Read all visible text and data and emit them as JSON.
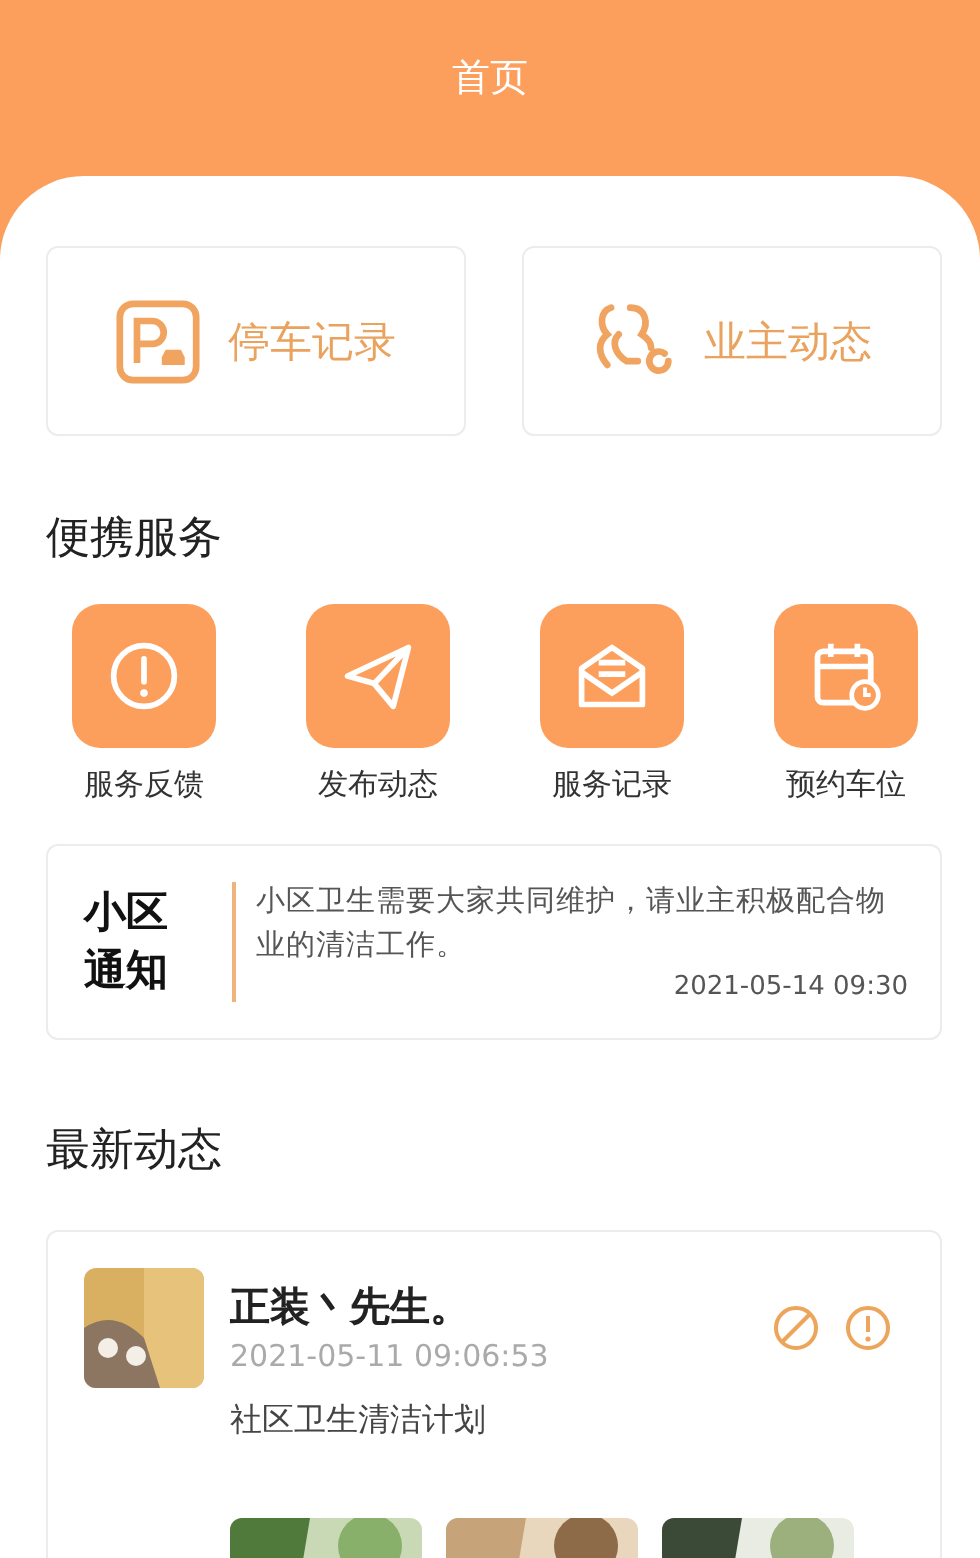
{
  "header": {
    "title": "首页"
  },
  "quick_cards": [
    {
      "kind": "parking",
      "label": "停车记录"
    },
    {
      "kind": "owners",
      "label": "业主动态"
    }
  ],
  "services": {
    "title": "便携服务",
    "items": [
      {
        "kind": "feedback",
        "label": "服务反馈"
      },
      {
        "kind": "publish",
        "label": "发布动态"
      },
      {
        "kind": "records",
        "label": "服务记录"
      },
      {
        "kind": "reserve",
        "label": "预约车位"
      }
    ]
  },
  "notice": {
    "title": "小区通知",
    "text": "小区卫生需要大家共同维护，请业主积极配合物业的清洁工作。",
    "time": "2021-05-14 09:30"
  },
  "feed": {
    "title": "最新动态",
    "posts": [
      {
        "author": "正装丶先生。",
        "time": "2021-05-11 09:06:53",
        "content": "社区卫生清洁计划"
      }
    ]
  }
}
